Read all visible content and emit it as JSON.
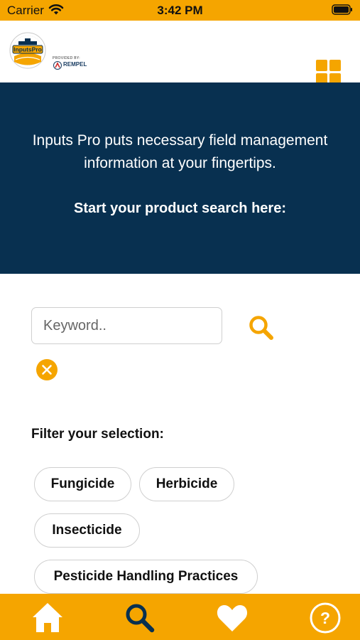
{
  "status_bar": {
    "carrier": "Carrier",
    "time": "3:42 PM"
  },
  "header": {
    "logo_text": "InputsPro",
    "provided_by": "PROVIDED BY:",
    "partner": "REMPEL",
    "menu_icon": "grid-icon"
  },
  "hero": {
    "line1": "Inputs Pro puts necessary field management information at your fingertips.",
    "cta": "Start your product search here:"
  },
  "search": {
    "placeholder": "Keyword..",
    "value": "",
    "search_icon": "search-icon",
    "clear_icon": "close-circle-icon"
  },
  "filters": {
    "heading": "Filter your selection:",
    "chips": [
      "Fungicide",
      "Herbicide",
      "Insecticide",
      "Pesticide Handling Practices"
    ]
  },
  "tab_bar": {
    "items": [
      {
        "icon": "home-icon",
        "active": false
      },
      {
        "icon": "search-icon",
        "active": true
      },
      {
        "icon": "heart-icon",
        "active": false
      },
      {
        "icon": "help-icon",
        "active": false
      }
    ]
  },
  "colors": {
    "accent": "#f5a500",
    "hero_bg": "#083050",
    "active_tab": "#083050",
    "text": "#111111"
  }
}
